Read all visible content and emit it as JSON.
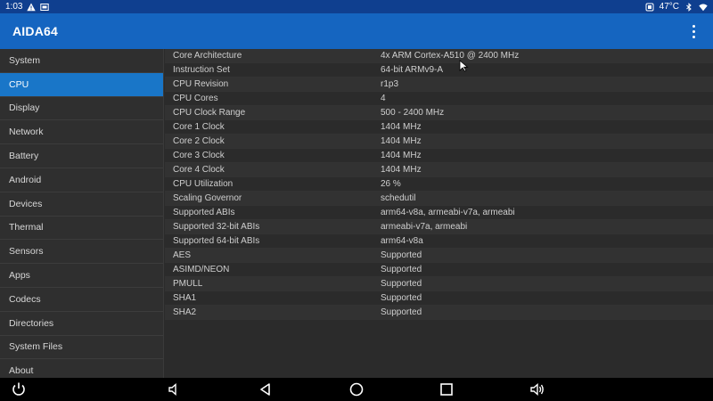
{
  "status_bar": {
    "time": "1:03",
    "temperature": "47°C",
    "icons": [
      "warning-icon",
      "screenshot-icon",
      "battery-icon",
      "bluetooth-icon",
      "wifi-icon"
    ]
  },
  "app_bar": {
    "title": "AIDA64",
    "menu_icon": "overflow-menu-icon"
  },
  "sidebar": {
    "items": [
      {
        "label": "System"
      },
      {
        "label": "CPU",
        "active": true
      },
      {
        "label": "Display"
      },
      {
        "label": "Network"
      },
      {
        "label": "Battery"
      },
      {
        "label": "Android"
      },
      {
        "label": "Devices"
      },
      {
        "label": "Thermal"
      },
      {
        "label": "Sensors"
      },
      {
        "label": "Apps"
      },
      {
        "label": "Codecs"
      },
      {
        "label": "Directories"
      },
      {
        "label": "System Files"
      },
      {
        "label": "About"
      }
    ]
  },
  "cpu_info": {
    "rows": [
      {
        "key": "Core Architecture",
        "value": "4x ARM Cortex-A510 @ 2400 MHz"
      },
      {
        "key": "Instruction Set",
        "value": "64-bit ARMv9-A"
      },
      {
        "key": "CPU Revision",
        "value": "r1p3"
      },
      {
        "key": "CPU Cores",
        "value": "4"
      },
      {
        "key": "CPU Clock Range",
        "value": "500 - 2400 MHz"
      },
      {
        "key": "Core 1 Clock",
        "value": "1404 MHz"
      },
      {
        "key": "Core 2 Clock",
        "value": "1404 MHz"
      },
      {
        "key": "Core 3 Clock",
        "value": "1404 MHz"
      },
      {
        "key": "Core 4 Clock",
        "value": "1404 MHz"
      },
      {
        "key": "CPU Utilization",
        "value": "26 %"
      },
      {
        "key": "Scaling Governor",
        "value": "schedutil"
      },
      {
        "key": "Supported ABIs",
        "value": "arm64-v8a, armeabi-v7a, armeabi"
      },
      {
        "key": "Supported 32-bit ABIs",
        "value": "armeabi-v7a, armeabi"
      },
      {
        "key": "Supported 64-bit ABIs",
        "value": "arm64-v8a"
      },
      {
        "key": "AES",
        "value": "Supported"
      },
      {
        "key": "ASIMD/NEON",
        "value": "Supported"
      },
      {
        "key": "PMULL",
        "value": "Supported"
      },
      {
        "key": "SHA1",
        "value": "Supported"
      },
      {
        "key": "SHA2",
        "value": "Supported"
      }
    ]
  },
  "nav_bar": {
    "buttons": [
      "power-icon",
      "volume-down-icon",
      "back-icon",
      "home-icon",
      "recents-icon",
      "volume-up-icon"
    ]
  },
  "colors": {
    "status_bar": "#0f3f8f",
    "app_bar": "#1565c0",
    "active_item": "#1976c8",
    "background": "#2b2b2b"
  }
}
